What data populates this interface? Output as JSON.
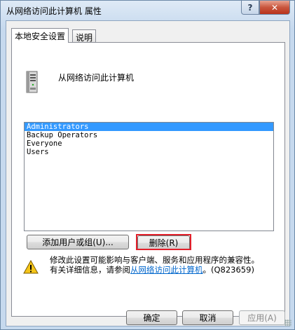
{
  "window": {
    "title": "从网络访问此计算机 属性",
    "help_label": "?",
    "close_label": "✕"
  },
  "tabs": [
    {
      "label": "本地安全设置",
      "active": true
    },
    {
      "label": "说明",
      "active": false
    }
  ],
  "policy": {
    "icon": "server-icon",
    "name": "从网络访问此计算机"
  },
  "list": {
    "items": [
      "Administrators",
      "Backup Operators",
      "Everyone",
      "Users"
    ],
    "selected_index": 0
  },
  "buttons": {
    "add": "添加用户或组(U)...",
    "remove": "删除(R)",
    "ok": "确定",
    "cancel": "取消",
    "apply": "应用(A)"
  },
  "warning": {
    "icon": "warning-icon",
    "line1": "修改此设置可能影响与客户端、服务和应用程序的兼容性。",
    "line2_prefix": "有关详细信息，请参阅",
    "line2_link": "从网络访问此计算机",
    "line2_suffix": "。(Q823659)"
  },
  "colors": {
    "selection": "#3399ff",
    "highlight_box": "#e3202b",
    "link": "#0066cc"
  }
}
